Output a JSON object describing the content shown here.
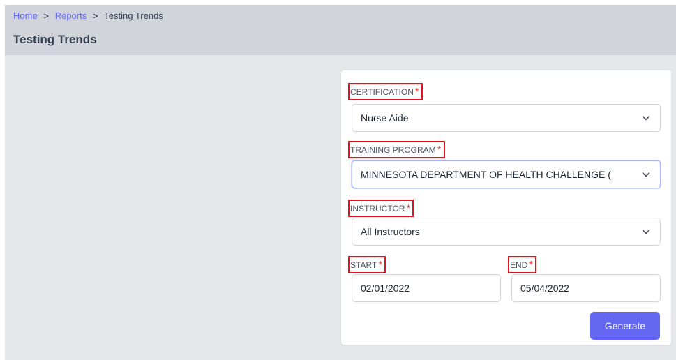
{
  "breadcrumb": {
    "home": "Home",
    "reports": "Reports",
    "current": "Testing Trends",
    "separator": ">"
  },
  "page_title": "Testing Trends",
  "form": {
    "certification": {
      "label": "CERTIFICATION",
      "required": "*",
      "value": "Nurse Aide"
    },
    "training_program": {
      "label": "TRAINING PROGRAM",
      "required": "*",
      "value": "MINNESOTA DEPARTMENT OF HEALTH CHALLENGE ("
    },
    "instructor": {
      "label": "INSTRUCTOR",
      "required": "*",
      "value": "All Instructors"
    },
    "start": {
      "label": "START",
      "required": "*",
      "value": "02/01/2022"
    },
    "end": {
      "label": "END",
      "required": "*",
      "value": "05/04/2022"
    },
    "generate_label": "Generate"
  },
  "colors": {
    "accent": "#6366f1",
    "required": "#ef4444",
    "highlight_box": "#e0141e"
  },
  "icons": {
    "select_chevron": "chevron-down-icon",
    "breadcrumb_separator": "chevron-right-icon"
  }
}
